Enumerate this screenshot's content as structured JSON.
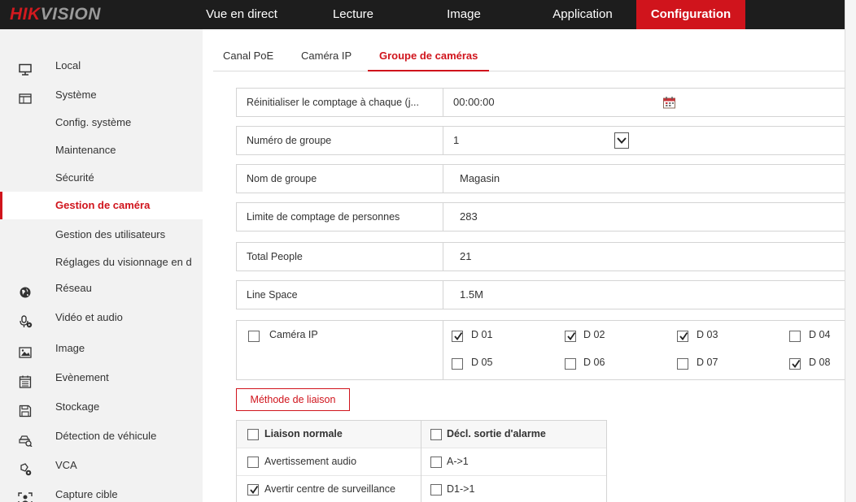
{
  "brand": {
    "part1": "HIK",
    "part2": "VISION"
  },
  "nav": [
    {
      "label": "Vue en direct",
      "active": false
    },
    {
      "label": "Lecture",
      "active": false
    },
    {
      "label": "Image",
      "active": false
    },
    {
      "label": "Application",
      "active": false
    },
    {
      "label": "Configuration",
      "active": true
    }
  ],
  "sidebar": [
    {
      "label": "Local",
      "icon": "monitor-icon"
    },
    {
      "label": "Système",
      "icon": "window-icon"
    },
    {
      "label": "Config. système"
    },
    {
      "label": "Maintenance"
    },
    {
      "label": "Sécurité"
    },
    {
      "label": "Gestion de caméra",
      "active": true
    },
    {
      "label": "Gestion des utilisateurs"
    },
    {
      "label": "Réglages du visionnage en d"
    },
    {
      "label": "Réseau",
      "icon": "globe-icon"
    },
    {
      "label": "Vidéo et audio",
      "icon": "microphone-icon"
    },
    {
      "label": "Image",
      "icon": "image-icon"
    },
    {
      "label": "Evènement",
      "icon": "calendar-icon"
    },
    {
      "label": "Stockage",
      "icon": "floppy-disk-icon"
    },
    {
      "label": "Détection de véhicule",
      "icon": "vehicle-detection-icon"
    },
    {
      "label": "VCA",
      "icon": "vca-icon"
    },
    {
      "label": "Capture cible",
      "icon": "capture-target-icon"
    }
  ],
  "tabs": [
    {
      "label": "Canal PoE",
      "active": false
    },
    {
      "label": "Caméra IP",
      "active": false
    },
    {
      "label": "Groupe de caméras",
      "active": true
    }
  ],
  "form": {
    "reset": {
      "label": "Réinitialiser le comptage à chaque (j...",
      "value": "00:00:00"
    },
    "group_number": {
      "label": "Numéro de groupe",
      "value": "1"
    },
    "group_name": {
      "label": "Nom de groupe",
      "value": "Magasin"
    },
    "limit": {
      "label": "Limite de comptage de personnes",
      "value": "283"
    },
    "total_people": {
      "label": "Total People",
      "value": "21"
    },
    "line_space": {
      "label": "Line Space",
      "value": "1.5M"
    }
  },
  "cameras": {
    "label": "Caméra IP",
    "all_checked": false,
    "items": [
      {
        "label": "D 01",
        "checked": true
      },
      {
        "label": "D 02",
        "checked": true
      },
      {
        "label": "D 03",
        "checked": true
      },
      {
        "label": "D 04",
        "checked": false
      },
      {
        "label": "D 05",
        "checked": false
      },
      {
        "label": "D 06",
        "checked": false
      },
      {
        "label": "D 07",
        "checked": false
      },
      {
        "label": "D 08",
        "checked": true
      }
    ]
  },
  "linkage_button": "Méthode de liaison",
  "linkage": {
    "col1_header": "Liaison normale",
    "col2_header": "Décl. sortie d'alarme",
    "rows": [
      {
        "left": "Avertissement audio",
        "left_checked": false,
        "right": "A->1",
        "right_checked": false
      },
      {
        "left": "Avertir centre de surveillance",
        "left_checked": true,
        "right": "D1->1",
        "right_checked": false
      }
    ]
  },
  "colors": {
    "accent": "#d0141c",
    "topbar": "#1d1d1d",
    "sidebar": "#f2f2f2"
  }
}
